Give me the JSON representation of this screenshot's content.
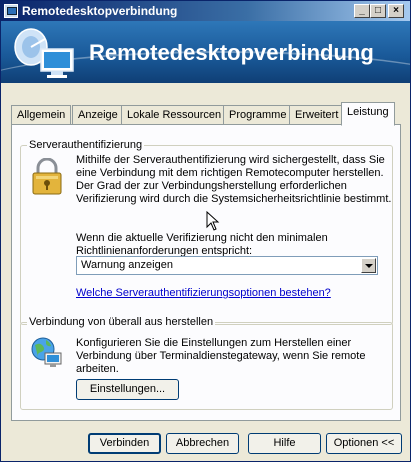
{
  "window": {
    "title": "Remotedesktopverbindung",
    "controls": {
      "minimize": "_",
      "maximize": "□",
      "close": "×"
    }
  },
  "banner": {
    "title": "Remotedesktopverbindung",
    "logo_icon": "computer-satellite-icon"
  },
  "tabs": [
    {
      "label": "Allgemein",
      "active": false
    },
    {
      "label": "Anzeige",
      "active": false
    },
    {
      "label": "Lokale Ressourcen",
      "active": false
    },
    {
      "label": "Programme",
      "active": false
    },
    {
      "label": "Erweitert",
      "active": false
    },
    {
      "label": "Leistung",
      "active": true
    }
  ],
  "server_auth": {
    "legend": "Serverauthentifizierung",
    "icon": "padlock-icon",
    "description": [
      "Mithilfe der Serverauthentifizierung wird sichergestellt, dass Sie",
      "eine Verbindung mit dem richtigen Remotecomputer herstellen.",
      "Der Grad der zur Verbindungsherstellung erforderlichen",
      "Verifizierung wird durch die Systemsicherheitsrichtlinie bestimmt."
    ],
    "condition": [
      "Wenn die aktuelle Verifizierung nicht den minimalen",
      "Richtlinienanforderungen entspricht:"
    ],
    "selected_option": "Warnung anzeigen",
    "link": "Welche Serverauthentifizierungsoptionen bestehen?"
  },
  "gateway": {
    "legend": "Verbindung von überall aus herstellen",
    "icon": "globe-computer-icon",
    "description": [
      "Konfigurieren Sie die Einstellungen zum Herstellen einer",
      "Verbindung über Terminaldienstegateway, wenn Sie remote",
      "arbeiten."
    ],
    "settings_button": "Einstellungen..."
  },
  "footer": {
    "connect": "Verbinden",
    "cancel": "Abbrechen",
    "help": "Hilfe",
    "options": "Optionen <<"
  },
  "colors": {
    "banner": "#1a5a9a",
    "titlebar": "#0a246a",
    "link": "#0000cc"
  }
}
